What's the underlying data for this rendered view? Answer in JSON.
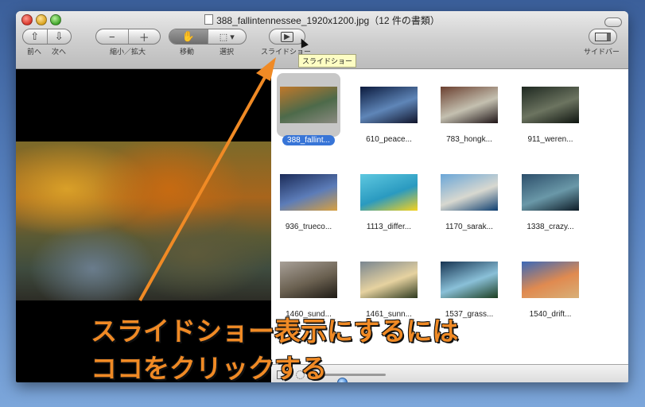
{
  "window": {
    "title": "388_fallintennessee_1920x1200.jpg（12 件の書類）"
  },
  "toolbar": {
    "prev_label": "前へ",
    "next_label": "次へ",
    "zoom_label": "縮小／拡大",
    "move_label": "移動",
    "select_label": "選択",
    "slideshow_label": "スライドショー",
    "sidebar_label": "サイドバー",
    "tooltip": "スライドショー"
  },
  "thumbnails": [
    {
      "label": "388_fallint...",
      "selected": true,
      "colors": [
        "#c0782a",
        "#4d6a4a",
        "#8a8a80"
      ]
    },
    {
      "label": "610_peace...",
      "selected": false,
      "colors": [
        "#0b1a3d",
        "#5f86b8",
        "#10142a"
      ]
    },
    {
      "label": "783_hongk...",
      "selected": false,
      "colors": [
        "#6b4030",
        "#c4c0b0",
        "#1e1416"
      ]
    },
    {
      "label": "911_weren...",
      "selected": false,
      "colors": [
        "#1e2820",
        "#6c7460",
        "#0e140f"
      ]
    },
    {
      "label": "936_trueco...",
      "selected": false,
      "colors": [
        "#1b2b58",
        "#5c7cb8",
        "#d8a040"
      ]
    },
    {
      "label": "1113_differ...",
      "selected": false,
      "colors": [
        "#5ec8e0",
        "#2a9ac0",
        "#f6d21c"
      ]
    },
    {
      "label": "1170_sarak...",
      "selected": false,
      "colors": [
        "#6aa6d8",
        "#d8d8d0",
        "#0e3e70"
      ]
    },
    {
      "label": "1338_crazy...",
      "selected": false,
      "colors": [
        "#2c4e6a",
        "#6a98a8",
        "#0d1b26"
      ]
    },
    {
      "label": "1460_sund...",
      "selected": false,
      "colors": [
        "#a8a098",
        "#6a6050",
        "#1e1a14"
      ]
    },
    {
      "label": "1461_sunn...",
      "selected": false,
      "colors": [
        "#7a8690",
        "#e6d2a0",
        "#2e3a20"
      ]
    },
    {
      "label": "1537_grass...",
      "selected": false,
      "colors": [
        "#173452",
        "#8ac0d8",
        "#1c3e20"
      ]
    },
    {
      "label": "1540_drift...",
      "selected": false,
      "colors": [
        "#3a68b8",
        "#e08a50",
        "#d8b078"
      ]
    }
  ],
  "caption": {
    "line1": "スライドショー表示にするには",
    "line2": "ココをクリックする",
    "color": "#f08a25"
  },
  "thumbnail_size_level": 0.35
}
